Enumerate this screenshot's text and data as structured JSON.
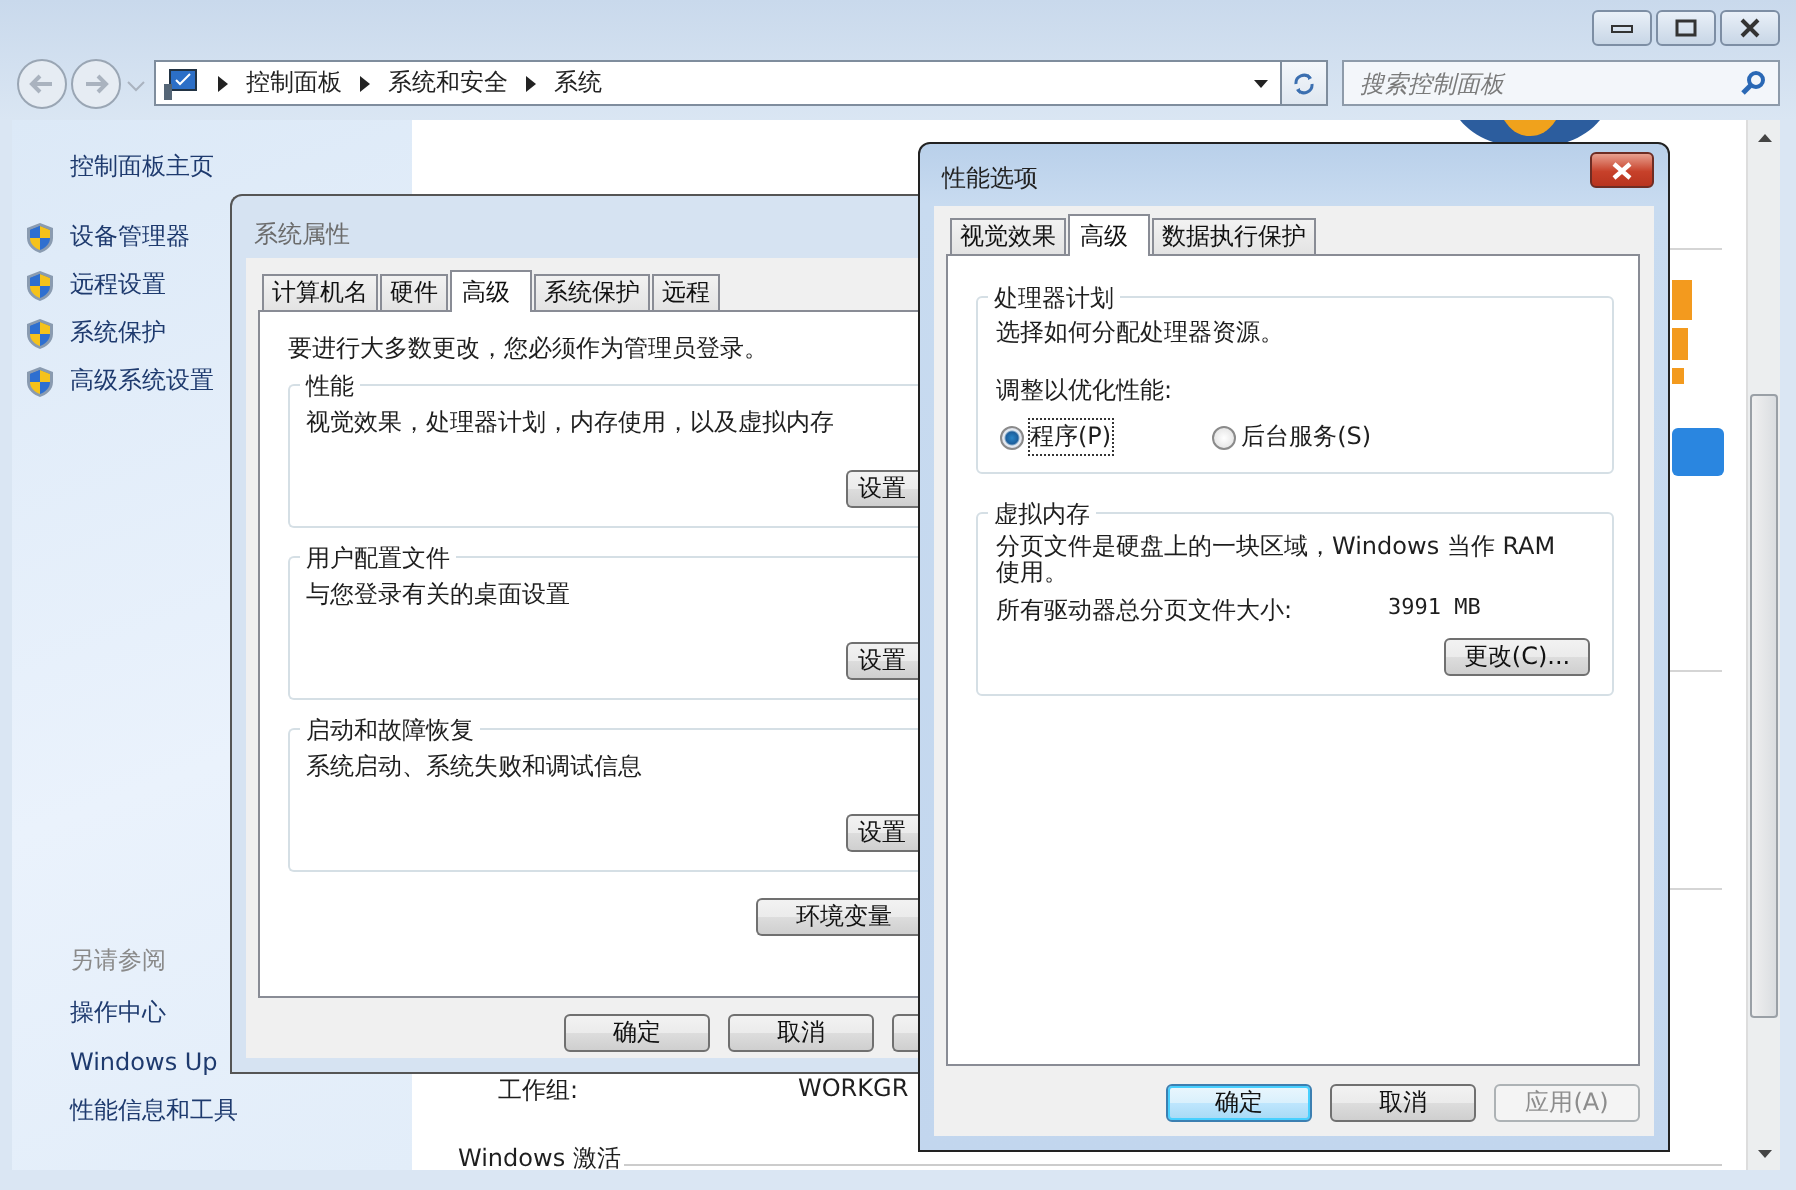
{
  "address_bar": {
    "breadcrumbs": [
      "控制面板",
      "系统和安全",
      "系统"
    ]
  },
  "search": {
    "placeholder": "搜索控制面板"
  },
  "sidebar": {
    "home": "控制面板主页",
    "tasks": [
      "设备管理器",
      "远程设置",
      "系统保护",
      "高级系统设置"
    ],
    "see_also_title": "另请参阅",
    "see_also": [
      "操作中心",
      "Windows Up",
      "性能信息和工具"
    ]
  },
  "content": {
    "rows": [
      {
        "label": "工作组:",
        "value": "WORKGR"
      }
    ],
    "section": "Windows 激活"
  },
  "system_properties": {
    "title": "系统属性",
    "tabs": [
      {
        "label": "计算机名",
        "selected": false
      },
      {
        "label": "硬件",
        "selected": false
      },
      {
        "label": "高级",
        "selected": true
      },
      {
        "label": "系统保护",
        "selected": false
      },
      {
        "label": "远程",
        "selected": false
      }
    ],
    "notice": "要进行大多数更改，您必须作为管理员登录。",
    "groups": [
      {
        "title": "性能",
        "description": "视觉效果，处理器计划，内存使用，以及虚拟内存",
        "button": "设置"
      },
      {
        "title": "用户配置文件",
        "description": "与您登录有关的桌面设置",
        "button": "设置"
      },
      {
        "title": "启动和故障恢复",
        "description": "系统启动、系统失败和调试信息",
        "button": "设置"
      }
    ],
    "env_button": "环境变量",
    "buttons": [
      "确定",
      "取消"
    ]
  },
  "performance_options": {
    "title": "性能选项",
    "tabs": [
      {
        "label": "视觉效果",
        "selected": false
      },
      {
        "label": "高级",
        "selected": true
      },
      {
        "label": "数据执行保护",
        "selected": false
      }
    ],
    "processor": {
      "title": "处理器计划",
      "description": "选择如何分配处理器资源。",
      "prompt": "调整以优化性能:",
      "options": [
        {
          "label": "程序(P)",
          "selected": true
        },
        {
          "label": "后台服务(S)",
          "selected": false
        }
      ]
    },
    "virtual_memory": {
      "title": "虚拟内存",
      "description": "分页文件是硬盘上的一块区域，Windows 当作 RAM 使用。",
      "size_label": "所有驱动器总分页文件大小:",
      "size_value": "3991 MB",
      "button": "更改(C)..."
    },
    "buttons": [
      {
        "label": "确定",
        "default": true,
        "disabled": false
      },
      {
        "label": "取消",
        "default": false,
        "disabled": false
      },
      {
        "label": "应用(A)",
        "default": false,
        "disabled": true
      }
    ]
  }
}
